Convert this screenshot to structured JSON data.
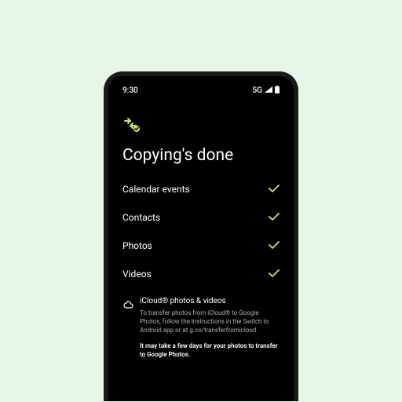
{
  "colors": {
    "accent": "#c3e678",
    "background": "#e8f5e9",
    "screen_bg": "#000000",
    "text": "#ffffff",
    "muted": "#b0b0b0"
  },
  "status_bar": {
    "time": "9:30",
    "network_label": "5G"
  },
  "header": {
    "title": "Copying's done"
  },
  "items": [
    {
      "label": "Calendar events",
      "done": true
    },
    {
      "label": "Contacts",
      "done": true
    },
    {
      "label": "Photos",
      "done": true
    },
    {
      "label": "Videos",
      "done": true
    }
  ],
  "info": {
    "title": "iCloud® photos & videos",
    "body": "To transfer photos from iCloud® to Google Photos, follow the instructions in the Switch to Android app or at g.co/transferfromicloud.",
    "note": "It may take a few days for your photos to transfer to Google Photos."
  }
}
